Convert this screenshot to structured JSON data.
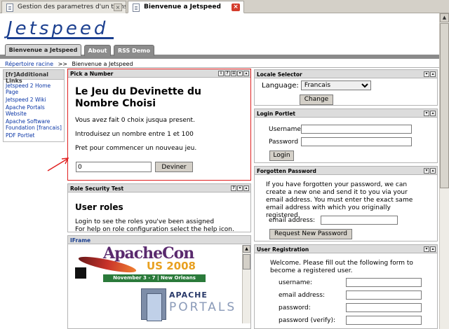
{
  "browser": {
    "tabs": [
      {
        "label": "Gestion des parametres d'un transport...",
        "icon": "page-icon"
      },
      {
        "label": "Bienvenue a Jetspeed",
        "icon": "page-icon"
      }
    ]
  },
  "header": {
    "logo": "Jetspeed"
  },
  "portal_tabs": [
    "Bienvenue a Jetspeed",
    "About",
    "RSS Demo"
  ],
  "breadcrumb": {
    "root": "Répertoire racine",
    "sep": ">>",
    "current": "Bienvenue a Jetspeed"
  },
  "links_panel": {
    "title": "[fr]Additional Links",
    "items": [
      "Jetspeed 2 Home Page",
      "Jetspeed 2 Wiki",
      "Apache Portals Website",
      "Apache Software Foundation [francais]",
      "PDF Portlet"
    ]
  },
  "pick_number": {
    "title": "Pick a Number",
    "heading": "Le Jeu du Devinette du Nombre Choisi",
    "line1": "Vous avez fait 0 choix jusqua present.",
    "line2": "Introduisez un nombre entre 1 et 100",
    "line3": "Pret pour commencer un nouveau jeu.",
    "input_value": "0",
    "button": "Deviner"
  },
  "role_security": {
    "title": "Role Security Test",
    "heading": "User roles",
    "line1": "Login to see the roles you've been assigned",
    "line2": "For help on role configuration select the help icon."
  },
  "iframe_portlet": {
    "title": "IFrame",
    "apachecon": "ApacheCon",
    "us": "US",
    "year": "2008",
    "dates": "November 3 - 7 | New Orleans",
    "apache": "APACHE",
    "portals": "PORTALS"
  },
  "locale": {
    "title": "Locale Selector",
    "language_label": "Language:",
    "selected": "Francais",
    "button": "Change"
  },
  "login": {
    "title": "Login Portlet",
    "username_label": "Username",
    "password_label": "Password",
    "button": "Login"
  },
  "forgotten": {
    "title": "Forgotten Password",
    "text": "If you have forgotten your password, we can create a new one and send it to you via your email address. You must enter the exact same email address with which you originally registered.",
    "email_label": "email address:",
    "button": "Request New Password"
  },
  "registration": {
    "title": "User Registration",
    "text": "Welcome. Please fill out the following form to become a registered user.",
    "fields": [
      "username:",
      "email address:",
      "password:",
      "password (verify):"
    ]
  }
}
